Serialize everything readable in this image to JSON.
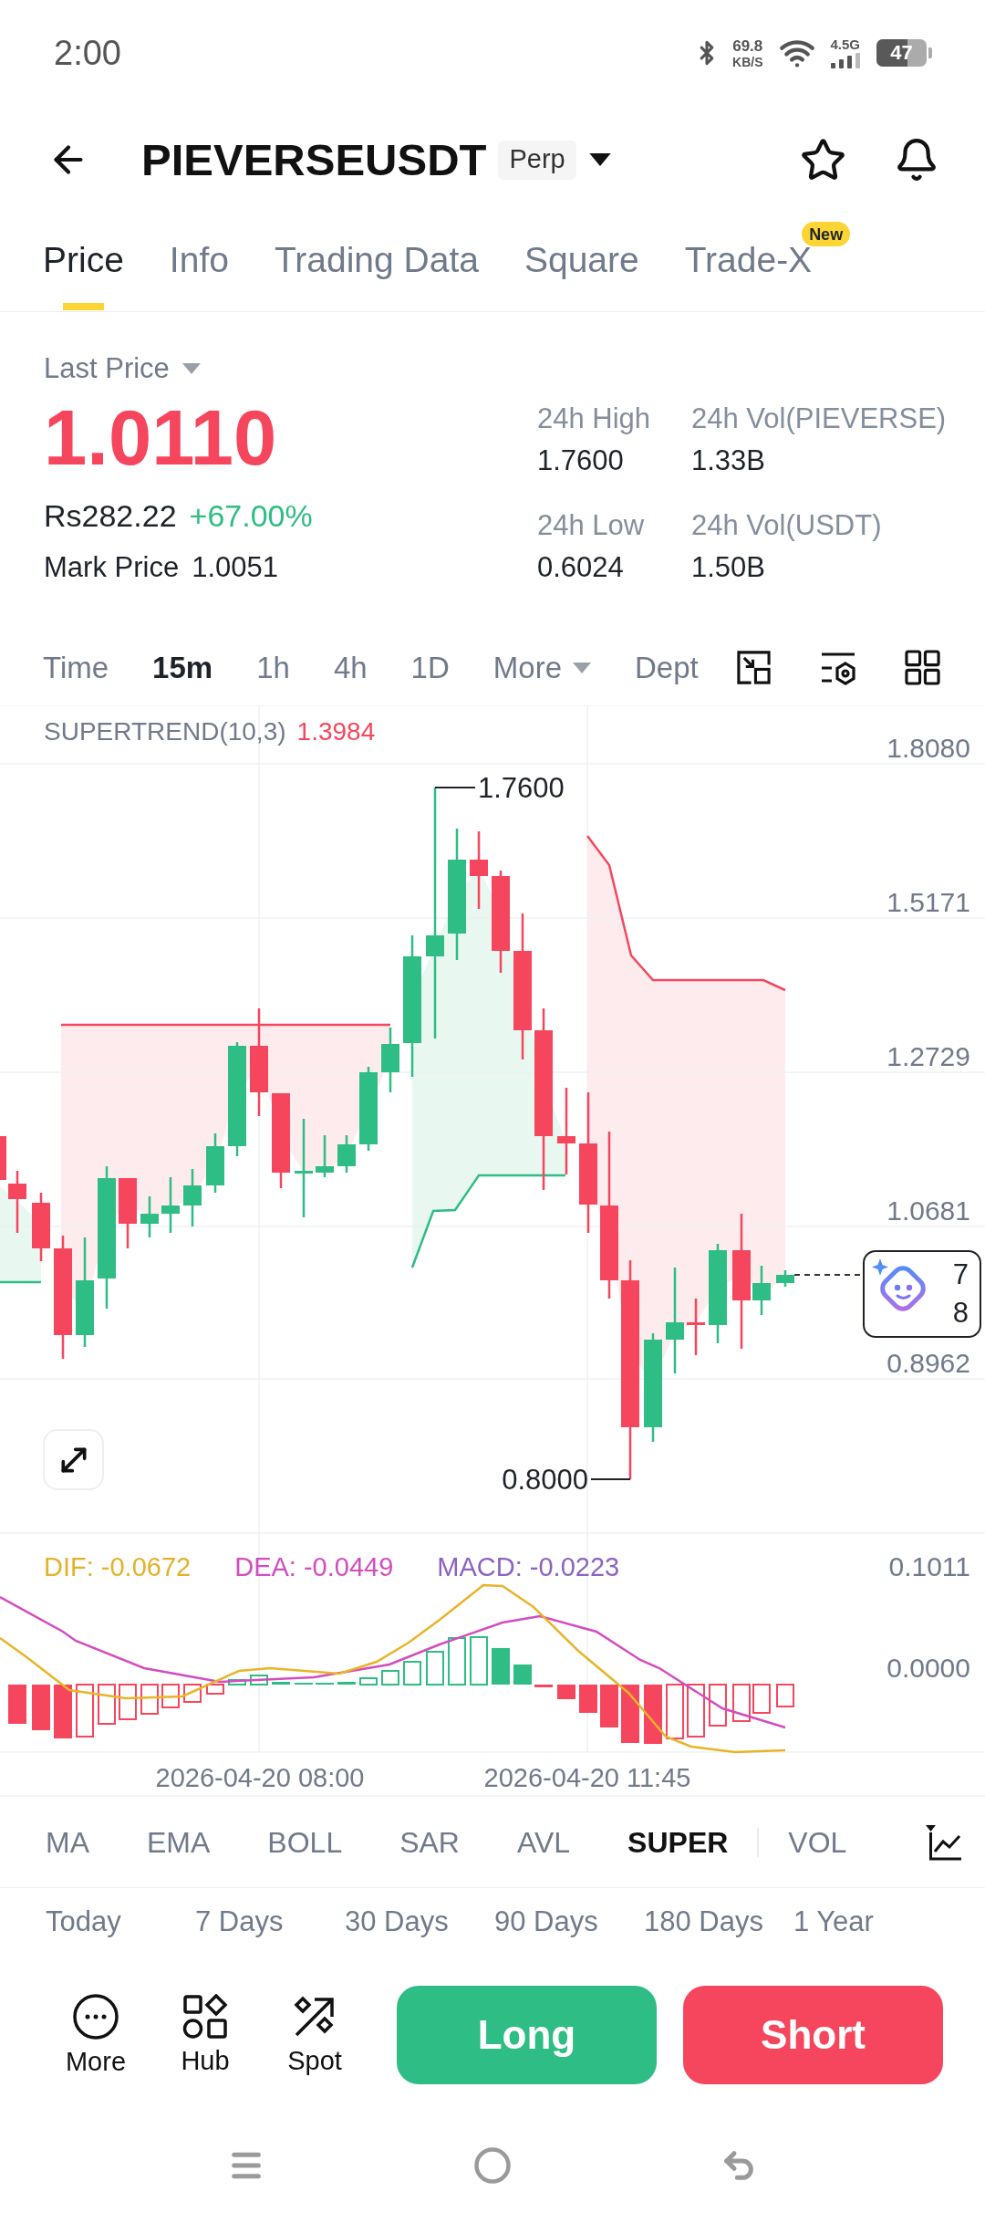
{
  "status_bar": {
    "time": "2:00",
    "net_speed": "69.8",
    "net_speed_unit": "KB/S",
    "network_type": "4.5G",
    "battery": "47"
  },
  "header": {
    "symbol": "PIEVERSEUSDT",
    "contract_type": "Perp"
  },
  "tabs": [
    {
      "label": "Price",
      "selected": true
    },
    {
      "label": "Info",
      "selected": false
    },
    {
      "label": "Trading Data",
      "selected": false
    },
    {
      "label": "Square",
      "selected": false
    },
    {
      "label": "Trade-X",
      "selected": false,
      "badge": "New"
    }
  ],
  "ticker": {
    "price_type": "Last Price",
    "last_price": "1.0110",
    "last_price_rising": false,
    "fiat_price": "Rs282.22",
    "change": "+67.00%",
    "change_rising": true,
    "mark_price_label": "Mark Price",
    "mark_price": "1.0051"
  },
  "stats": [
    {
      "label": "24h High",
      "value": "1.7600"
    },
    {
      "label": "24h Vol(PIEVERSE)",
      "value": "1.33B"
    },
    {
      "label": "24h Low",
      "value": "0.6024"
    },
    {
      "label": "24h Vol(USDT)",
      "value": "1.50B"
    }
  ],
  "intervals": [
    {
      "label": "Time",
      "selected": false,
      "kind": "tab"
    },
    {
      "label": "15m",
      "selected": true,
      "kind": "tab"
    },
    {
      "label": "1h",
      "selected": false,
      "kind": "tab"
    },
    {
      "label": "4h",
      "selected": false,
      "kind": "tab"
    },
    {
      "label": "1D",
      "selected": false,
      "kind": "tab"
    },
    {
      "label": "More",
      "selected": false,
      "kind": "menu"
    },
    {
      "label": "Dept",
      "selected": false,
      "kind": "tab"
    }
  ],
  "chart": {
    "indicator": "SUPERTREND(10,3)",
    "indicator_value": "1.3984",
    "price_axis": [
      "1.8080",
      "1.5171",
      "1.2729",
      "1.0681",
      "0.8962"
    ],
    "high_marker": "1.7600",
    "low_marker": "0.8000",
    "price_tag": [
      "7",
      "8"
    ]
  },
  "macd": {
    "dif": "DIF: -0.0672",
    "dea": "DEA: -0.0449",
    "macd": "MACD: -0.0223",
    "axis": [
      "0.1011",
      "0.0000"
    ]
  },
  "time_axis": [
    "2026-04-20 08:00",
    "2026-04-20 11:45"
  ],
  "indicators": [
    {
      "label": "MA",
      "selected": false,
      "kind": "overlay"
    },
    {
      "label": "EMA",
      "selected": false,
      "kind": "overlay"
    },
    {
      "label": "BOLL",
      "selected": false,
      "kind": "overlay"
    },
    {
      "label": "SAR",
      "selected": false,
      "kind": "overlay"
    },
    {
      "label": "AVL",
      "selected": false,
      "kind": "overlay"
    },
    {
      "label": "SUPER",
      "selected": true,
      "kind": "overlay"
    },
    {
      "label": "VOL",
      "selected": false,
      "kind": "pane"
    }
  ],
  "periods": [
    "Today",
    "7 Days",
    "30 Days",
    "90 Days",
    "180 Days",
    "1 Year"
  ],
  "actions": [
    "More",
    "Hub",
    "Spot"
  ],
  "trade_buttons": [
    {
      "label": "Long",
      "kind": "buy"
    },
    {
      "label": "Short",
      "kind": "sell"
    }
  ]
}
